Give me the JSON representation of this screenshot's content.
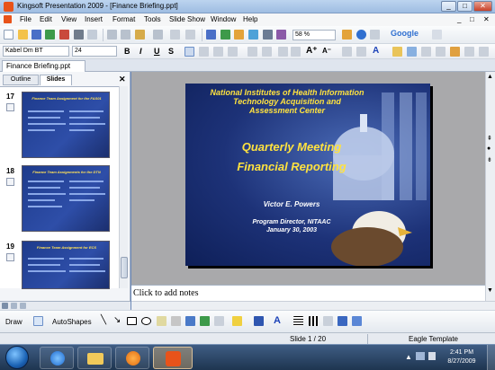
{
  "window": {
    "title": "Kingsoft Presentation 2009 - [Finance Briefing.ppt]",
    "min": "_",
    "max": "□",
    "close": "✕"
  },
  "menu": [
    "File",
    "Edit",
    "View",
    "Insert",
    "Format",
    "Tools",
    "Slide Show",
    "Window",
    "Help"
  ],
  "toolbar": {
    "zoom": "58 %",
    "google": "Google"
  },
  "formatbar": {
    "font": "Kabel Dm BT",
    "size": "24",
    "bold": "B",
    "italic": "I",
    "underline": "U",
    "shadow": "S"
  },
  "doc_tab": "Finance Briefing.ppt",
  "pane_tabs": [
    "Outline",
    "Slides"
  ],
  "thumbnails": [
    {
      "num": "17",
      "title": "Finance Team Assignment for the FAS01"
    },
    {
      "num": "18",
      "title": "Finance Team Assignments for the DTN"
    },
    {
      "num": "19",
      "title": "Finance Team Assignment for ECS"
    }
  ],
  "slide": {
    "title_line1": "National Institutes of Health Information",
    "title_line2": "Technology Acquisition and",
    "title_line3": "Assessment Center",
    "heading1": "Quarterly Meeting",
    "heading2": "Financial Reporting",
    "presenter": "Victor E. Powers",
    "role": "Program Director, NITAAC",
    "date": "January 30, 2003"
  },
  "notes_placeholder": "Click to add notes",
  "drawbar": {
    "draw": "Draw",
    "autoshapes": "AutoShapes"
  },
  "status": {
    "slide": "Slide 1 / 20",
    "template": "Eagle Template"
  },
  "clock": {
    "time": "2:41 PM",
    "date": "8/27/2009"
  },
  "colors": {
    "slide_title": "#ffe23f",
    "slide_bg": "#1d3278",
    "selection": "#f0b428"
  }
}
